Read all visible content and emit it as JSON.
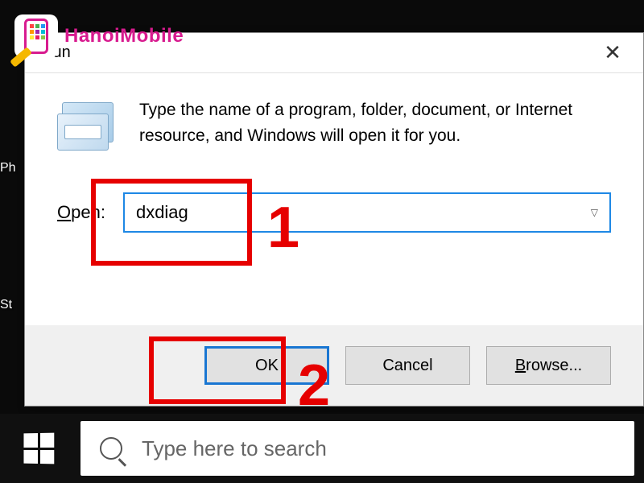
{
  "watermark": {
    "text": "HanoiMobile"
  },
  "window": {
    "title": "Run",
    "description": "Type the name of a program, folder, document, or Internet resource, and Windows will open it for you.",
    "open_label": "Open:",
    "open_value": "dxdiag",
    "buttons": {
      "ok": "OK",
      "cancel": "Cancel",
      "browse": "Browse..."
    }
  },
  "desktop": {
    "partial_labels": [
      "Ph",
      "St"
    ]
  },
  "taskbar": {
    "search_placeholder": "Type here to search"
  },
  "annotations": {
    "step1": "1",
    "step2": "2"
  }
}
